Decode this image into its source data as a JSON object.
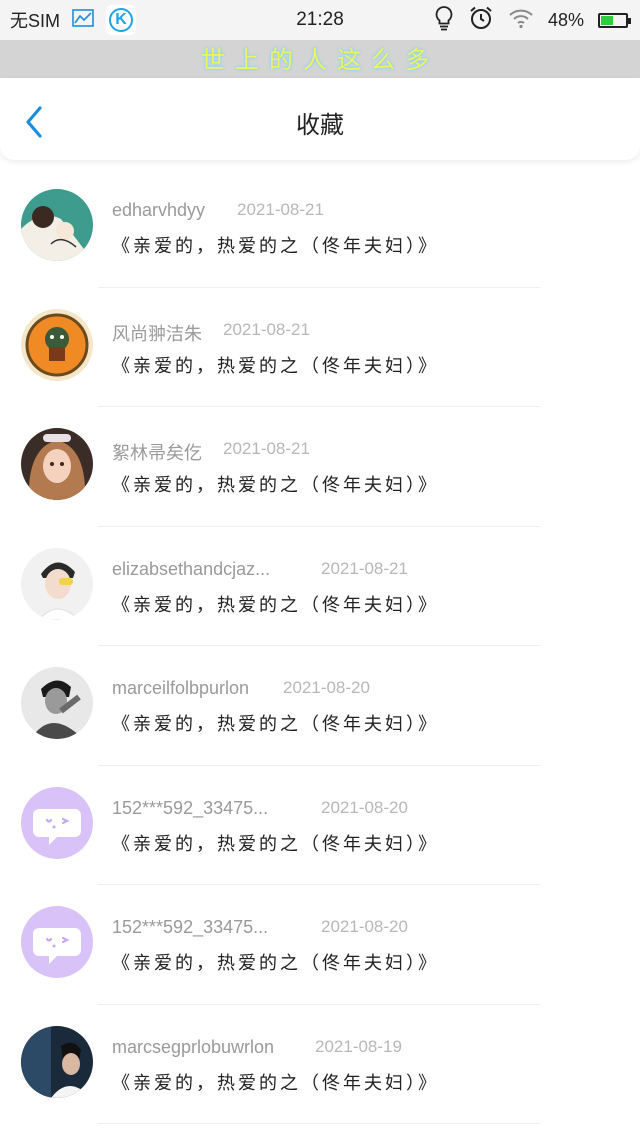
{
  "status_bar": {
    "carrier": "无SIM",
    "time": "21:28",
    "battery_percent": "48%",
    "battery_level": 0.48,
    "icons": [
      "chart-icon",
      "k-app-icon",
      "lightbulb-icon",
      "alarm-icon",
      "wifi-icon",
      "battery-icon"
    ]
  },
  "banner": {
    "text": "世上的人这么多"
  },
  "nav": {
    "title": "收藏",
    "back_icon": "chevron-left-icon"
  },
  "colors": {
    "accent": "#1a8fe0",
    "name_gray": "#9a9a9a",
    "date_gray": "#b8b8b8",
    "banner_text": "#f2f25a"
  },
  "favorites": [
    {
      "name": "edharvhdyy",
      "date": "2021-08-21",
      "title": "《亲爱的，热爱的之（佟年夫妇）》",
      "avatar": "photo-avatar-teal"
    },
    {
      "name": "风尚翀洁朱",
      "date": "2021-08-21",
      "title": "《亲爱的，热爱的之（佟年夫妇）》",
      "avatar": "illustrated-avatar-orange"
    },
    {
      "name": "絮林帚矣仡",
      "date": "2021-08-21",
      "title": "《亲爱的，热爱的之（佟年夫妇）》",
      "avatar": "photo-avatar-girl"
    },
    {
      "name": "elizabsethandcjaz...",
      "date": "2021-08-21",
      "title": "《亲爱的，热爱的之（佟年夫妇）》",
      "avatar": "photo-avatar-boy"
    },
    {
      "name": "marceilfolbpurlon",
      "date": "2021-08-20",
      "title": "《亲爱的，热爱的之（佟年夫妇）》",
      "avatar": "photo-avatar-bw"
    },
    {
      "name": "152***592_33475...",
      "date": "2021-08-20",
      "title": "《亲爱的，热爱的之（佟年夫妇）》",
      "avatar": "default-chat-avatar"
    },
    {
      "name": "152***592_33475...",
      "date": "2021-08-20",
      "title": "《亲爱的，热爱的之（佟年夫妇）》",
      "avatar": "default-chat-avatar"
    },
    {
      "name": "marcsegprlobuwrlon",
      "date": "2021-08-19",
      "title": "《亲爱的，热爱的之（佟年夫妇）》",
      "avatar": "photo-avatar-dark"
    }
  ]
}
